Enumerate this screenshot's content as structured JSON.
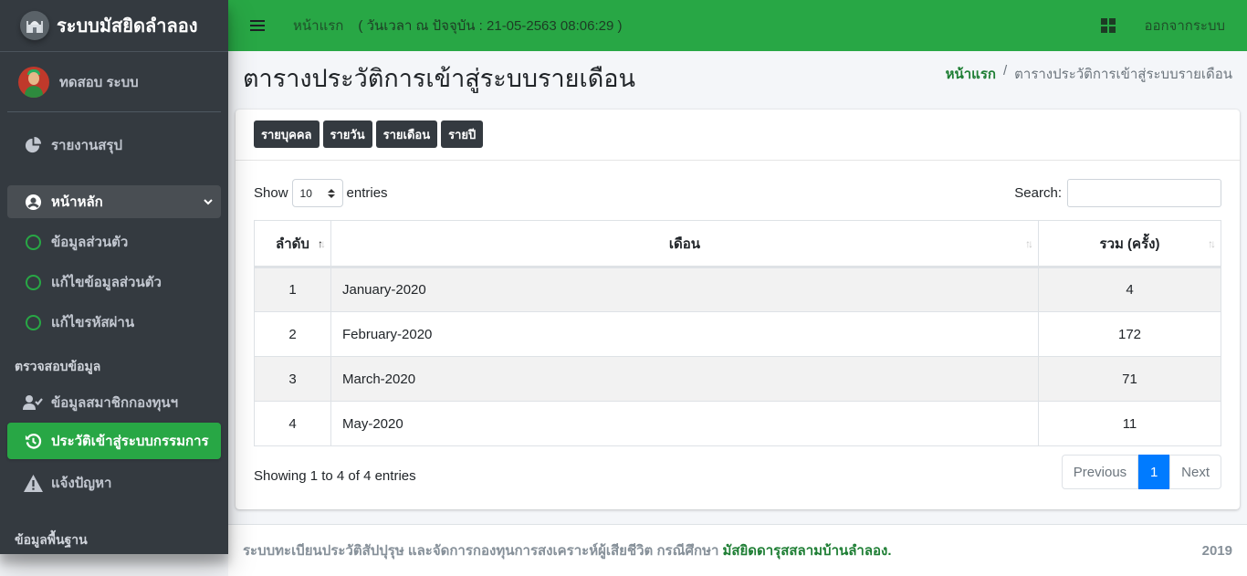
{
  "brand": {
    "title": "ระบบมัสยิดลำลอง"
  },
  "user": {
    "name": "ทดสอบ ระบบ"
  },
  "sidebar": {
    "report": "รายงานสรุป",
    "main_menu": "หน้าหลัก",
    "sub_items": [
      "ข้อมูลส่วนตัว",
      "แก้ไขข้อมูลส่วนตัว",
      "แก้ไขรหัสผ่าน"
    ],
    "section_header": "ตรวจสอบข้อมูล",
    "members": "ข้อมูลสมาชิกกองทุนฯ",
    "history": "ประวัติเข้าสู่ระบบกรรมการ",
    "report_issue": "แจ้งปัญหา",
    "cut_header": "ข้อมูลพื้นฐาน"
  },
  "topbar": {
    "home": "หน้าแรก",
    "time": "( วันเวลา ณ ปัจจุบัน : 21-05-2563 08:06:29 )",
    "logout": "ออกจากระบบ"
  },
  "page": {
    "title": "ตารางประวัติการเข้าสู่ระบบรายเดือน",
    "breadcrumb_home": "หน้าแรก",
    "breadcrumb_sep": "/",
    "breadcrumb_current": "ตารางประวัติการเข้าสู่ระบบรายเดือน"
  },
  "tabs": [
    "รายบุคคล",
    "รายวัน",
    "รายเดือน",
    "รายปี"
  ],
  "controls": {
    "show": "Show",
    "entries_value": "10",
    "entries": "entries",
    "search": "Search:"
  },
  "table": {
    "headers": [
      "ลำดับ",
      "เดือน",
      "รวม (ครั้ง)"
    ],
    "rows": [
      {
        "no": "1",
        "month": "January-2020",
        "total": "4"
      },
      {
        "no": "2",
        "month": "February-2020",
        "total": "172"
      },
      {
        "no": "3",
        "month": "March-2020",
        "total": "71"
      },
      {
        "no": "4",
        "month": "May-2020",
        "total": "11"
      }
    ]
  },
  "info": "Showing 1 to 4 of 4 entries",
  "pager": {
    "previous": "Previous",
    "current": "1",
    "next": "Next"
  },
  "footer": {
    "text": "ระบบทะเบียนประวัติสัปปุรุษ และจัดการกองทุนการสงเคราะห์ผู้เสียชีวิต กรณีศึกษา",
    "link": "มัสยิดดารุสสลามบ้านลำลอง.",
    "year": "2019"
  },
  "colors": {
    "primary": "#28a745",
    "sidebar": "#343a40",
    "page_active": "#007bff"
  }
}
